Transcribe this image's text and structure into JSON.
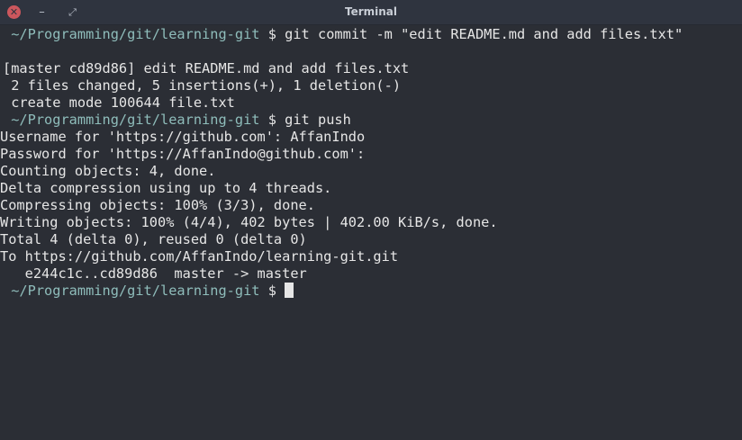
{
  "window": {
    "title": "Terminal",
    "close_glyph": "✕",
    "minimize_glyph": "–",
    "restore_glyph": "⤢"
  },
  "terminal": {
    "prompt_path": " ~/Programming/git/learning-git",
    "prompt_symbol": " $ ",
    "cmd1": "git commit -m \"edit README.md and add files.txt\"",
    "commit_line": "[master cd89d86] edit README.md and add files.txt",
    "changes_line": " 2 files changed, 5 insertions(+), 1 deletion(-)",
    "create_line": " create mode 100644 file.txt",
    "cmd2": "git push",
    "output": [
      "Username for 'https://github.com': AffanIndo",
      "Password for 'https://AffanIndo@github.com':",
      "Counting objects: 4, done.",
      "Delta compression using up to 4 threads.",
      "Compressing objects: 100% (3/3), done.",
      "Writing objects: 100% (4/4), 402 bytes | 402.00 KiB/s, done.",
      "Total 4 (delta 0), reused 0 (delta 0)",
      "To https://github.com/AffanIndo/learning-git.git",
      "   e244c1c..cd89d86  master -> master"
    ]
  },
  "colors": {
    "background": "#2b2e35",
    "titlebar": "#2f343f",
    "prompt_path": "#8fbdbb",
    "text": "#e6e6e6",
    "close_button": "#cc575d"
  }
}
